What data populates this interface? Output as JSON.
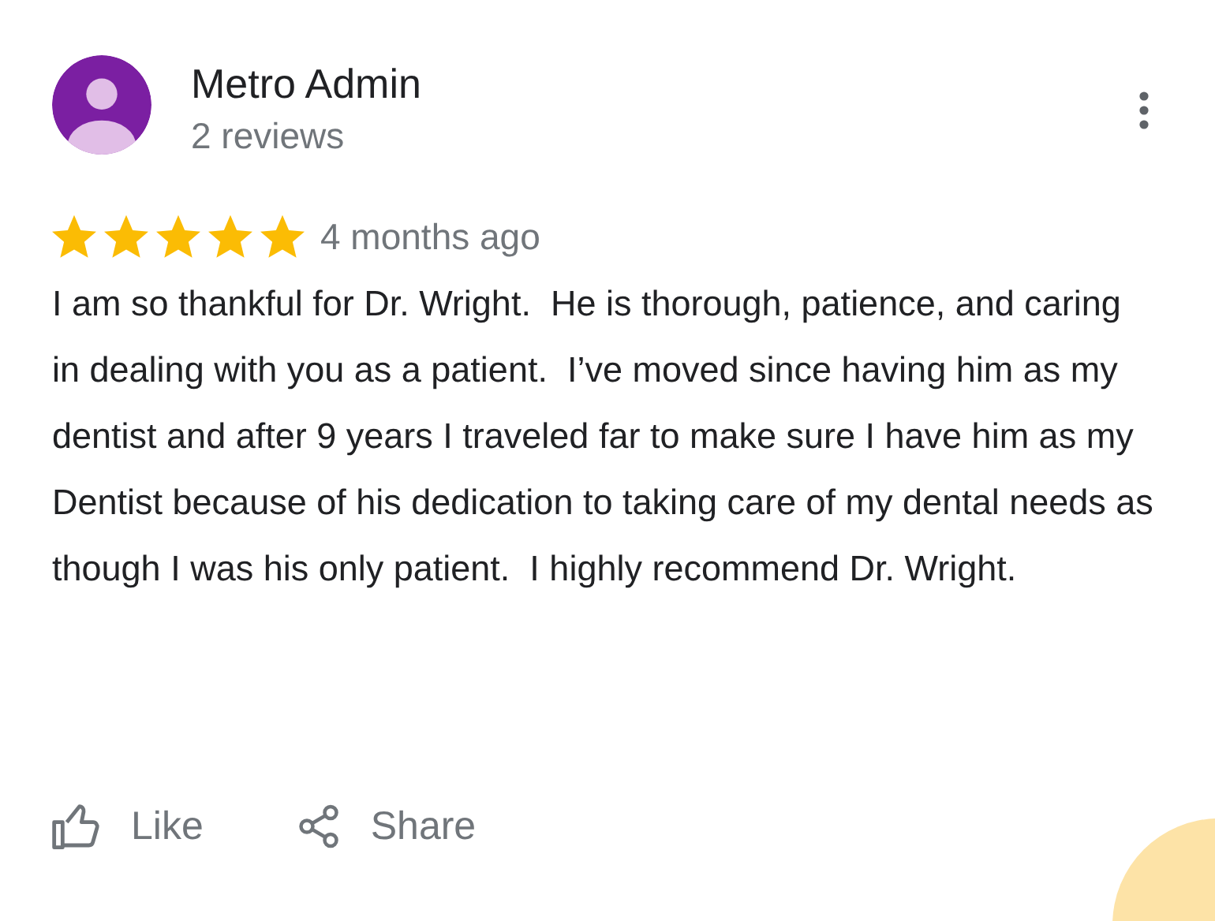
{
  "reviewer": {
    "name": "Metro Admin",
    "review_count": "2 reviews"
  },
  "review": {
    "stars": 5,
    "time": "4 months ago",
    "text": "I am so thankful for Dr. Wright.  He is thorough, patience, and caring in dealing with you as a patient.  I’ve moved since having him as my dentist and after 9 years I traveled far to make sure I have him as my Dentist because of his dedication to taking care of my dental needs as though I was his only patient.  I highly recommend Dr. Wright."
  },
  "actions": [
    {
      "kind": "like",
      "label": "Like"
    },
    {
      "kind": "share",
      "label": "Share"
    }
  ]
}
